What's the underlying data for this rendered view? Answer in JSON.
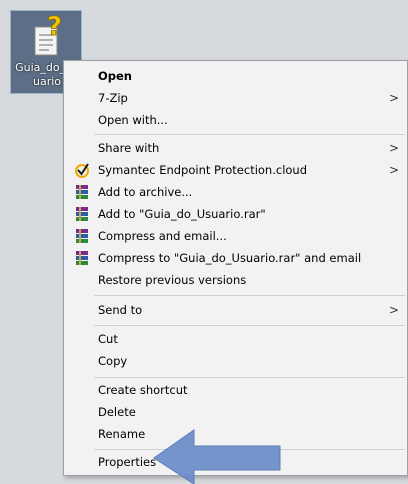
{
  "desktop": {
    "file_label": "Guia_do_Usuario"
  },
  "menu": {
    "items": [
      {
        "label": "Open"
      },
      {
        "label": "7-Zip"
      },
      {
        "label": "Open with..."
      },
      {
        "label": "Share with"
      },
      {
        "label": "Symantec Endpoint Protection.cloud"
      },
      {
        "label": "Add to archive..."
      },
      {
        "label": "Add to \"Guia_do_Usuario.rar\""
      },
      {
        "label": "Compress and email..."
      },
      {
        "label": "Compress to \"Guia_do_Usuario.rar\" and email"
      },
      {
        "label": "Restore previous versions"
      },
      {
        "label": "Send to"
      },
      {
        "label": "Cut"
      },
      {
        "label": "Copy"
      },
      {
        "label": "Create shortcut"
      },
      {
        "label": "Delete"
      },
      {
        "label": "Rename"
      },
      {
        "label": "Properties"
      }
    ],
    "submenu_glyph": ">"
  },
  "colors": {
    "arrow": "#6f8fc9",
    "symantec_check": "#f2a900"
  }
}
